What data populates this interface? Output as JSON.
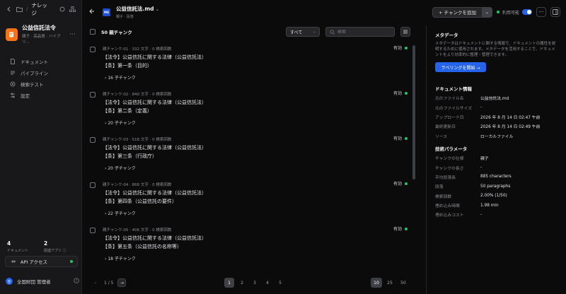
{
  "sidebar": {
    "crumb": "ナレッジ",
    "kb_title": "公益信託法令",
    "kb_sub": "親子 · 高品質 · ハイブリ...",
    "nav": [
      {
        "label": "ドキュメント",
        "icon": "document-icon"
      },
      {
        "label": "パイプライン",
        "icon": "pipeline-icon"
      },
      {
        "label": "検索テスト",
        "icon": "search-test-icon"
      },
      {
        "label": "設定",
        "icon": "settings-icon"
      }
    ],
    "stats": [
      {
        "num": "4",
        "label": "ドキュメント"
      },
      {
        "num": "2",
        "label": "関連アプリ ⓘ"
      }
    ],
    "api_label": "API アクセス",
    "user_name": "全国財団 管理者"
  },
  "header": {
    "doc_badge": "MD",
    "doc_title": "公益信託法.md",
    "doc_sub": "親子 · 段落",
    "add_chunk": "チャンクを追加",
    "available": "利用可能"
  },
  "chunks": {
    "count_label": "50 親チャンク",
    "filter_value": "すべて",
    "search_placeholder": "検索",
    "items": [
      {
        "meta": "親チャンク-01 · 332 文字 · 0 検索回数",
        "line1": "【法令】公益信託に関する法律（公益信託法）",
        "line2": "【条】第一条（目的）",
        "children": "16 子チャンク",
        "status": "有効"
      },
      {
        "meta": "親チャンク-02 · 840 文字 · 0 検索回数",
        "line1": "【法令】公益信託に関する法律（公益信託法）",
        "line2": "【条】第二条（定義）",
        "children": "20 子チャンク",
        "status": "有効"
      },
      {
        "meta": "親チャンク-03 · 518 文字 · 0 検索回数",
        "line1": "【法令】公益信託に関する法律（公益信託法）",
        "line2": "【条】第三条（行政庁）",
        "children": "20 子チャンク",
        "status": "有効"
      },
      {
        "meta": "親チャンク-04 · 868 文字 · 0 検索回数",
        "line1": "【法令】公益信託に関する法律（公益信託法）",
        "line2": "【条】第四条（公益信託の要件）",
        "children": "22 子チャンク",
        "status": "有効"
      },
      {
        "meta": "親チャンク-05 · 406 文字 · 0 検索回数",
        "line1": "【法令】公益信託に関する法律（公益信託法）",
        "line2": "【条】第五条（公益信託の名称等）",
        "children": "18 子チャンク",
        "status": "有効"
      }
    ],
    "pager": {
      "page_info": "1 / 5",
      "pages": [
        "1",
        "2",
        "3",
        "4",
        "5"
      ],
      "sizes": [
        "10",
        "25",
        "50"
      ]
    }
  },
  "info": {
    "metadata_title": "メタデータ",
    "metadata_desc": "メタデータはドキュメントに関する情報で、ドキュメントの属性を説明するために使用されます。メタデータを活用することで、ドキュメントをより効率的に整理・管理できます。",
    "labeling_button": "ラベリングを開始 →",
    "doc_info_title": "ドキュメント情報",
    "doc_info": [
      {
        "k": "元のファイル名",
        "v": "公益信託法.md"
      },
      {
        "k": "元のファイルサイズ",
        "v": "-"
      },
      {
        "k": "アップロード日",
        "v": "2026 年 8 月 14 日 02:47 午前"
      },
      {
        "k": "最終更新日",
        "v": "2026 年 8 月 14 日 02:49 午前"
      },
      {
        "k": "ソース",
        "v": "ローカルファイル"
      }
    ],
    "tech_title": "技術パラメータ",
    "tech": [
      {
        "k": "チャンクの仕様",
        "v": "親子"
      },
      {
        "k": "チャンクの長さ",
        "v": "-"
      },
      {
        "k": "平均段落長",
        "v": "885 characters"
      },
      {
        "k": "段落",
        "v": "50 paragraphs"
      },
      {
        "k": "検索回数",
        "v": "2.00% (1/50)"
      },
      {
        "k": "埋め込み時間",
        "v": "1.98 min"
      },
      {
        "k": "埋め込みコスト",
        "v": "-"
      }
    ]
  }
}
